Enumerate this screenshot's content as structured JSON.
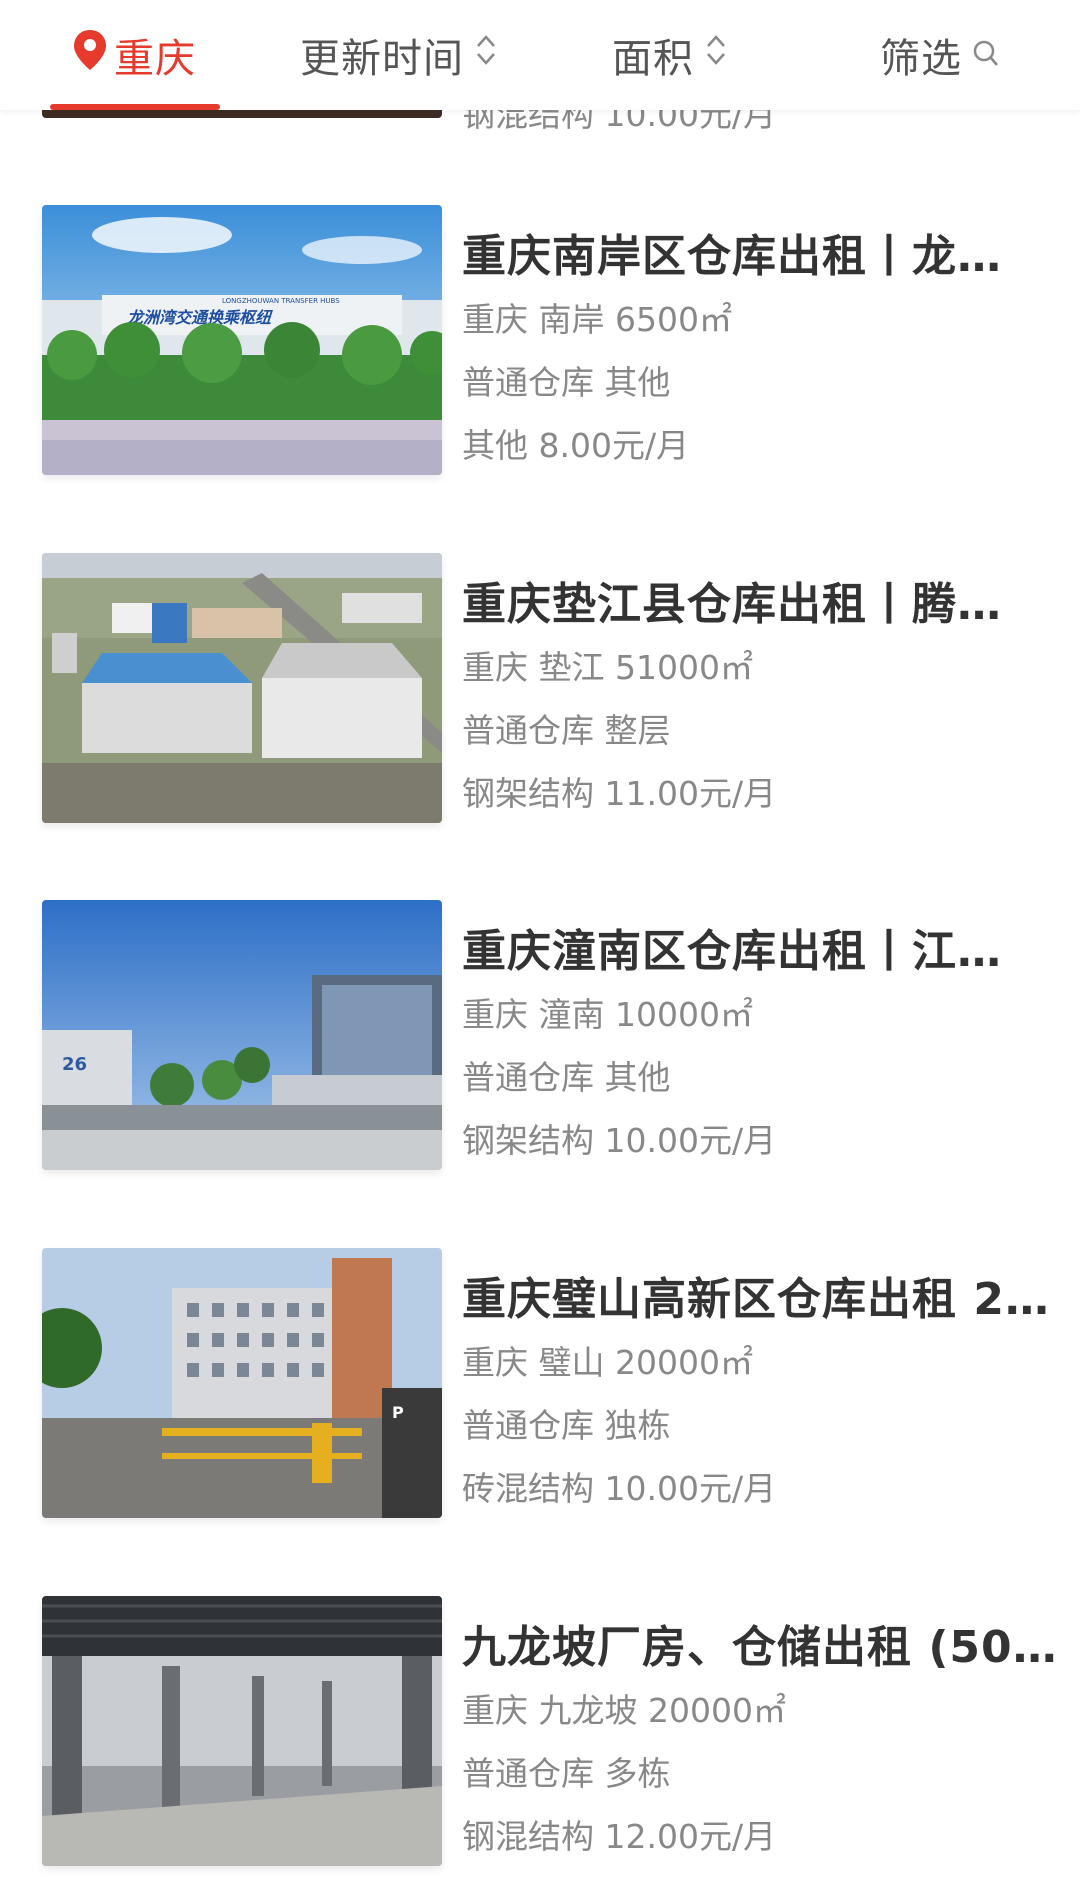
{
  "filter_bar": {
    "city": "重庆",
    "updated": "更新时间",
    "area": "面积",
    "filter": "筛选"
  },
  "partial_previous": {
    "text": "钢混结构 10.00元/月"
  },
  "listings": [
    {
      "title": "重庆南岸区仓库出租丨龙…",
      "location": "重庆 南岸 6500㎡",
      "type": "普通仓库 其他",
      "price": "其他 8.00元/月",
      "photo_sign": "LONGZHOUWAN TRANSFER HUBS"
    },
    {
      "title": "重庆垫江县仓库出租丨腾…",
      "location": "重庆 垫江 51000㎡",
      "type": "普通仓库 整层",
      "price": "钢架结构 11.00元/月"
    },
    {
      "title": "重庆潼南区仓库出租丨江…",
      "location": "重庆 潼南 10000㎡",
      "type": "普通仓库 其他",
      "price": "钢架结构 10.00元/月"
    },
    {
      "title": "重庆璧山高新区仓库出租 2…",
      "location": "重庆 璧山 20000㎡",
      "type": "普通仓库 独栋",
      "price": "砖混结构 10.00元/月"
    },
    {
      "title": "九龙坡厂房、仓储出租 (50…",
      "location": "重庆 九龙坡 20000㎡",
      "type": "普通仓库 多栋",
      "price": "钢混结构 12.00元/月"
    }
  ],
  "colors": {
    "accent": "#e53a2c",
    "title": "#333333",
    "meta": "#888888"
  },
  "icons": {
    "city": "map-pin-icon",
    "sort": "sort-updown-icon",
    "filter": "search-icon"
  }
}
